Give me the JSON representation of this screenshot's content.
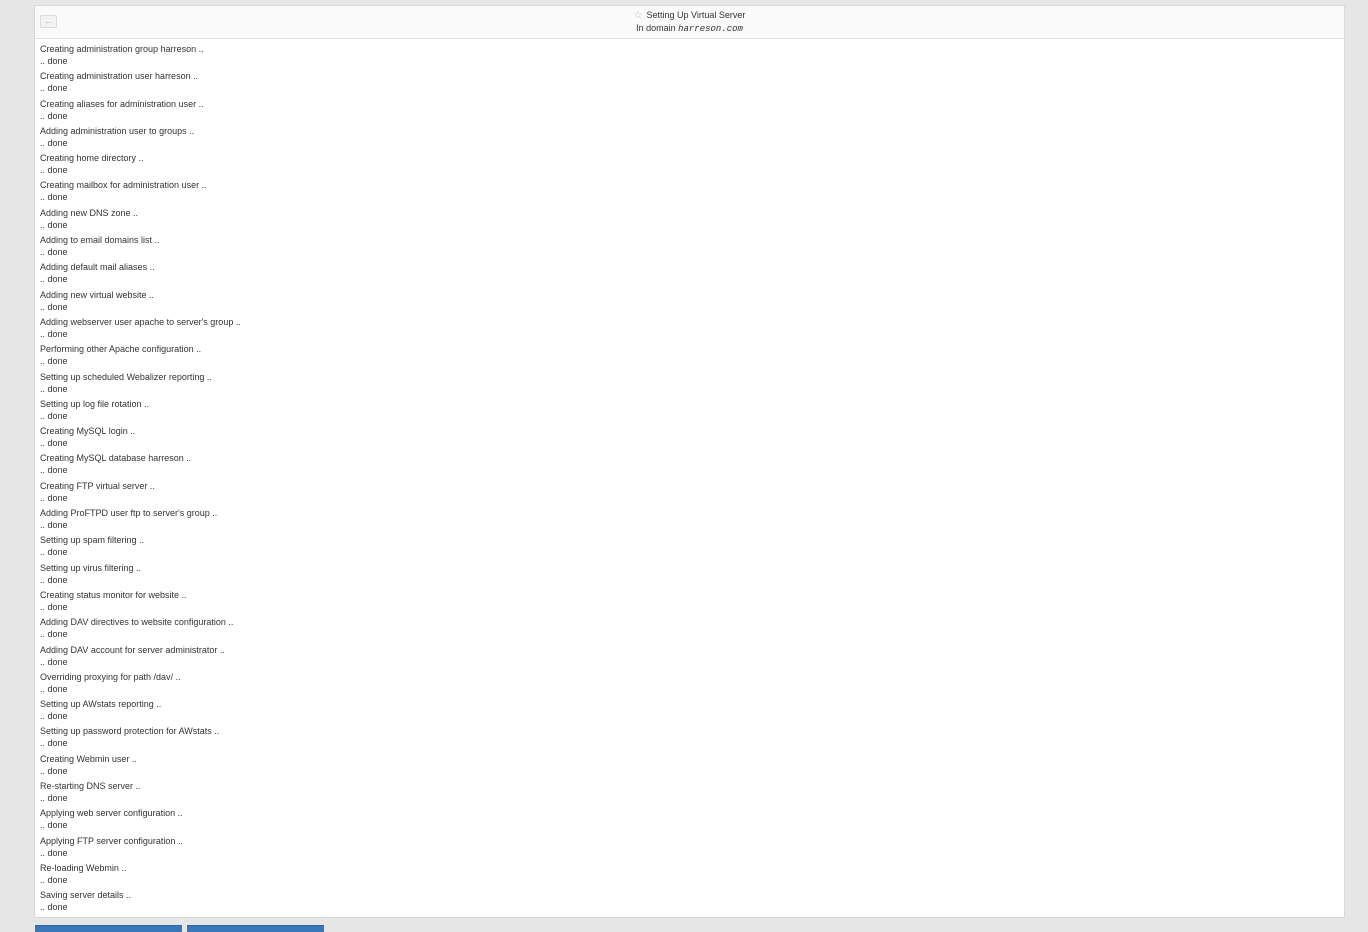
{
  "header": {
    "back_icon": "arrow-left-icon",
    "star_icon": "star-icon",
    "title": "Setting Up Virtual Server",
    "subtitle_prefix": "In domain",
    "domain": "harreson.com"
  },
  "log": [
    {
      "action": "Creating administration group harreson ..",
      "status": ".. done"
    },
    {
      "action": "Creating administration user harreson ..",
      "status": ".. done"
    },
    {
      "action": "Creating aliases for administration user ..",
      "status": ".. done"
    },
    {
      "action": "Adding administration user to groups ..",
      "status": ".. done"
    },
    {
      "action": "Creating home directory ..",
      "status": ".. done"
    },
    {
      "action": "Creating mailbox for administration user ..",
      "status": ".. done"
    },
    {
      "action": "Adding new DNS zone ..",
      "status": ".. done"
    },
    {
      "action": "Adding to email domains list ..",
      "status": ".. done"
    },
    {
      "action": "Adding default mail aliases ..",
      "status": ".. done"
    },
    {
      "action": "Adding new virtual website ..",
      "status": ".. done"
    },
    {
      "action": "Adding webserver user apache to server's group ..",
      "status": ".. done"
    },
    {
      "action": "Performing other Apache configuration ..",
      "status": ".. done"
    },
    {
      "action": "Setting up scheduled Webalizer reporting ..",
      "status": ".. done"
    },
    {
      "action": "Setting up log file rotation ..",
      "status": ".. done"
    },
    {
      "action": "Creating MySQL login ..",
      "status": ".. done"
    },
    {
      "action": "Creating MySQL database harreson ..",
      "status": ".. done"
    },
    {
      "action": "Creating FTP virtual server ..",
      "status": ".. done"
    },
    {
      "action": "Adding ProFTPD user ftp to server's group ..",
      "status": ".. done"
    },
    {
      "action": "Setting up spam filtering ..",
      "status": ".. done"
    },
    {
      "action": "Setting up virus filtering ..",
      "status": ".. done"
    },
    {
      "action": "Creating status monitor for website ..",
      "status": ".. done"
    },
    {
      "action": "Adding DAV directives to website configuration ..",
      "status": ".. done"
    },
    {
      "action": "Adding DAV account for server administrator ..",
      "status": ".. done"
    },
    {
      "action": "Overriding proxying for path /dav/ ..",
      "status": ".. done"
    },
    {
      "action": "Setting up AWstats reporting ..",
      "status": ".. done"
    },
    {
      "action": "Setting up password protection for AWstats ..",
      "status": ".. done"
    },
    {
      "action": "Creating Webmin user ..",
      "status": ".. done"
    },
    {
      "action": "Re-starting DNS server ..",
      "status": ".. done"
    },
    {
      "action": "Applying web server configuration ..",
      "status": ".. done"
    },
    {
      "action": "Applying FTP server configuration ..",
      "status": ".. done"
    },
    {
      "action": "Re-loading Webmin ..",
      "status": ".. done"
    },
    {
      "action": "Saving server details ..",
      "status": ".. done"
    }
  ],
  "colors": {
    "button": "#3a77b8",
    "background": "#e6e6e6"
  }
}
